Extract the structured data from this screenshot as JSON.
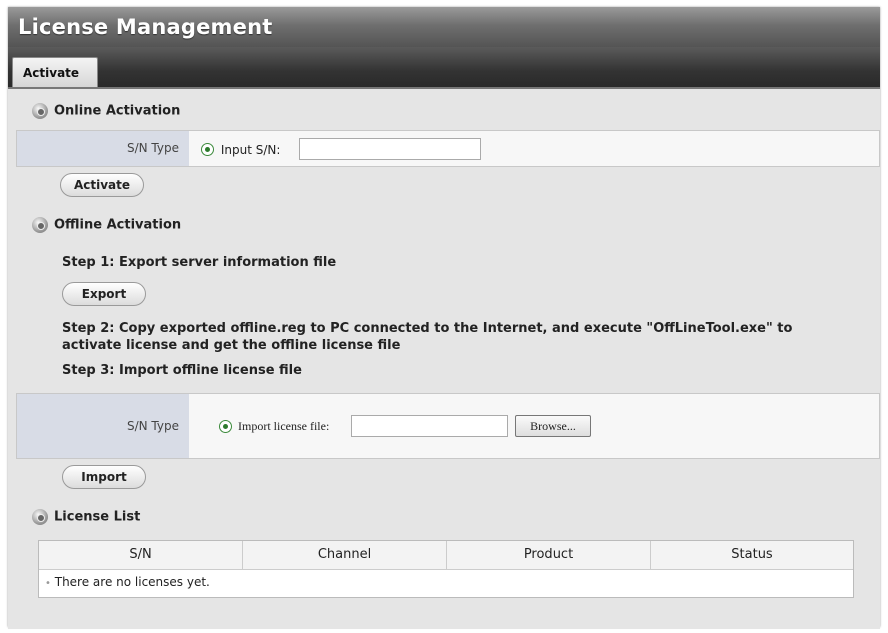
{
  "window": {
    "title": "License Management"
  },
  "tabs": [
    {
      "label": "Activate",
      "active": true
    }
  ],
  "online": {
    "heading": "Online Activation",
    "sn_type_label": "S/N Type",
    "option_label": "Input S/N:",
    "input_value": "",
    "button_label": "Activate"
  },
  "offline": {
    "heading": "Offline Activation",
    "step1": "Step 1: Export server information file",
    "export_label": "Export",
    "step2_line1": "Step 2: Copy exported offline.reg to PC connected to the Internet, and execute \"OffLineTool.exe\" to",
    "step2_line2": "activate license and get the offline license file",
    "step3": "Step 3: Import offline license file",
    "sn_type_label": "S/N Type",
    "option_label": "Import license file:",
    "file_value": "",
    "browse_label": "Browse...",
    "import_label": "Import"
  },
  "license_list": {
    "heading": "License List",
    "columns": [
      "S/N",
      "Channel",
      "Product",
      "Status"
    ],
    "empty_message": "There are no licenses yet."
  }
}
